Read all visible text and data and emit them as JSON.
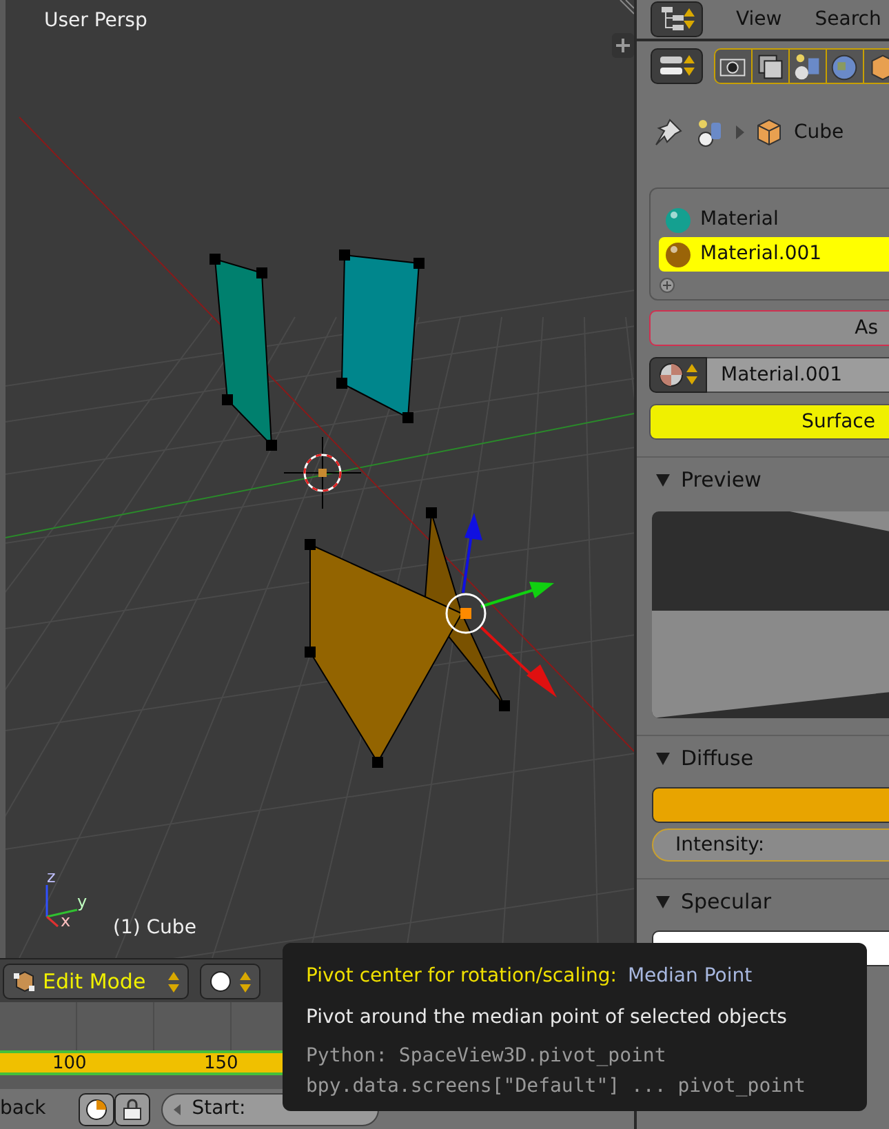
{
  "viewport": {
    "view_name": "User Persp",
    "object_name": "(1) Cube",
    "axis_labels": [
      "z",
      "y",
      "x"
    ]
  },
  "view3d_header": {
    "mode": "Edit Mode"
  },
  "timeline": {
    "frame_numbers": [
      "100",
      "150"
    ]
  },
  "timeline_header": {
    "menu": "back",
    "start_label": "Start:"
  },
  "properties": {
    "menus": [
      "View",
      "Search"
    ],
    "breadcrumb": "Cube",
    "material_slots": [
      {
        "name": "Material",
        "color": "#14a090",
        "selected": false
      },
      {
        "name": "Material.001",
        "color": "#9a6408",
        "selected": true
      }
    ],
    "assign_button": "As",
    "material_name": "Material.001",
    "surface_tab": "Surface",
    "panels": [
      {
        "title": "Preview",
        "kind": "preview"
      },
      {
        "title": "Diffuse",
        "kind": "color",
        "color": "#e8a400",
        "fields": [
          "Intensity:"
        ]
      },
      {
        "title": "Specular",
        "kind": "color",
        "color": "#ffffff"
      }
    ]
  },
  "tooltip": {
    "title": "Pivot center for rotation/scaling:",
    "value": "Median Point",
    "description": "Pivot around the median point of selected objects",
    "python": [
      "Python: SpaceView3D.pivot_point",
      "bpy.data.screens[\"Default\"] ... pivot_point"
    ]
  }
}
